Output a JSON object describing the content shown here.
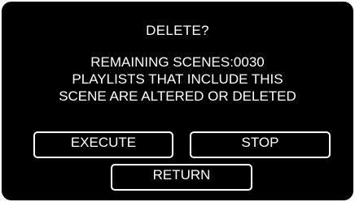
{
  "dialog": {
    "title": "DELETE?",
    "message_lines": [
      "REMAINING SCENES:0030",
      "PLAYLISTS THAT INCLUDE THIS",
      "SCENE ARE ALTERED OR DELETED"
    ]
  },
  "buttons": {
    "execute_label": "EXECUTE",
    "stop_label": "STOP",
    "return_label": "RETURN"
  },
  "colors": {
    "background": "#000000",
    "text": "#ffffff",
    "button_border": "#ffffff"
  }
}
